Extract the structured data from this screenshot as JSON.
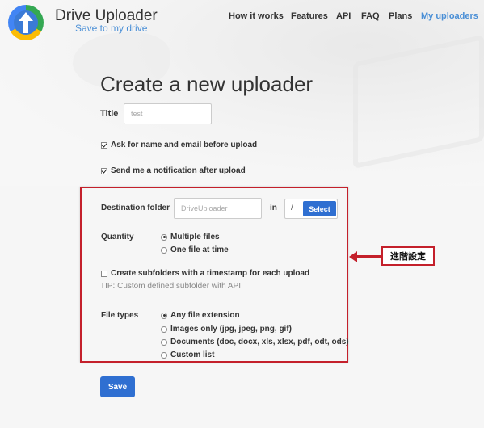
{
  "header": {
    "brand": "Drive Uploader",
    "tagline": "Save to my drive",
    "nav": [
      "How it works",
      "Features",
      "API",
      "FAQ",
      "Plans",
      "My uploaders"
    ]
  },
  "page": {
    "title": "Create a new uploader"
  },
  "form": {
    "title_label": "Title",
    "title_value": "test",
    "ask_name_email": {
      "label": "Ask for name and email before upload",
      "checked": true
    },
    "send_notification": {
      "label": "Send me a notification after upload",
      "checked": true
    },
    "destination": {
      "label": "Destination folder",
      "placeholder": "DriveUploader",
      "in_label": "in",
      "path": "/",
      "select_label": "Select"
    },
    "quantity": {
      "label": "Quantity",
      "options": [
        "Multiple files",
        "One file at time"
      ],
      "selected": "Multiple files"
    },
    "subfolders": {
      "label": "Create subfolders with a timestamp for each upload",
      "checked": false
    },
    "tip": "TIP: Custom defined subfolder with API",
    "file_types": {
      "label": "File types",
      "options": [
        "Any file extension",
        "Images only (jpg, jpeg, png, gif)",
        "Documents (doc, docx, xls, xlsx, pdf, odt, ods)",
        "Custom list"
      ],
      "selected": "Any file extension"
    },
    "save_label": "Save"
  },
  "annotation": {
    "label": "進階設定",
    "color": "#c4202b"
  },
  "colors": {
    "accent": "#2f6fd1",
    "link": "#4a8fd6"
  }
}
